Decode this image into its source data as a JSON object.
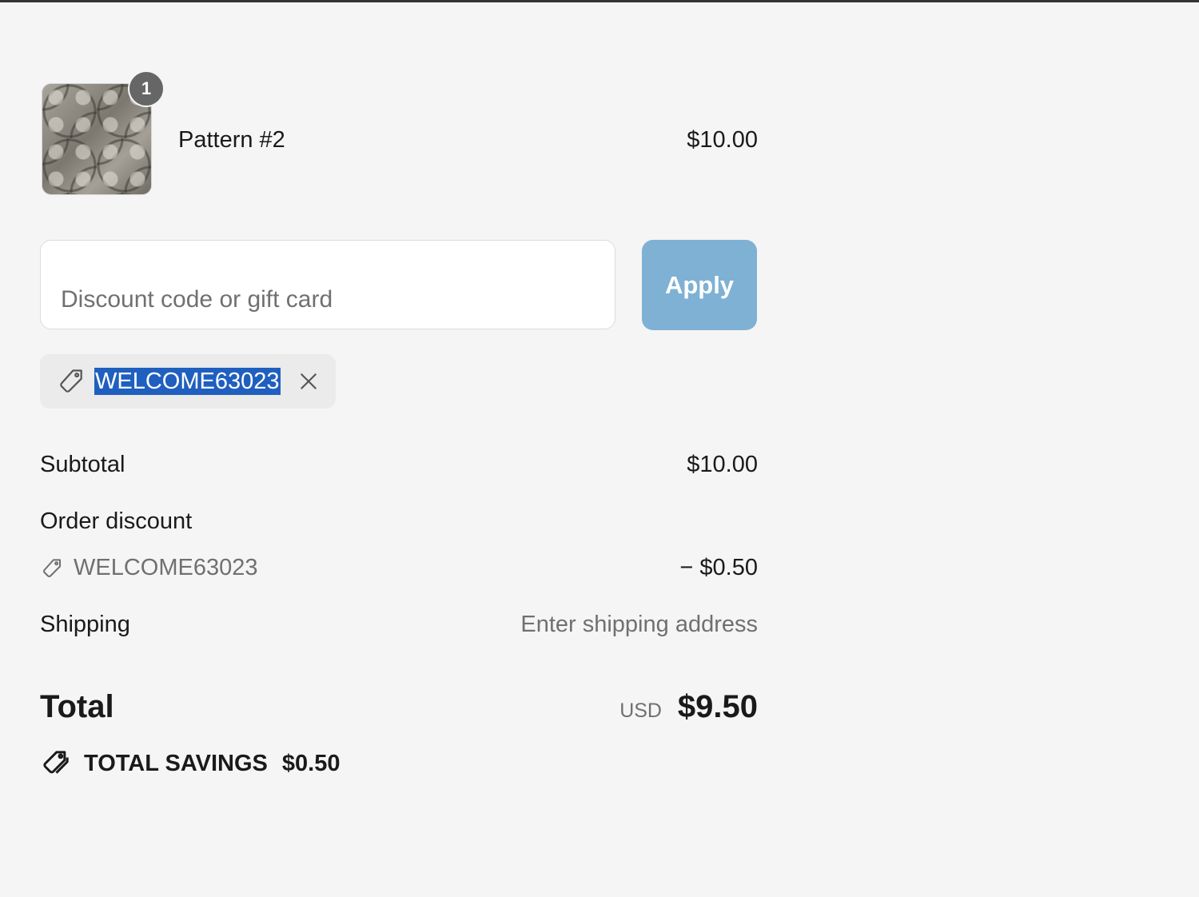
{
  "product": {
    "name": "Pattern #2",
    "price": "$10.00",
    "quantity": "1"
  },
  "discount": {
    "placeholder": "Discount code or gift card",
    "value": "",
    "apply_label": "Apply",
    "applied_code": "WELCOME63023"
  },
  "summary": {
    "subtotal_label": "Subtotal",
    "subtotal_value": "$10.00",
    "order_discount_label": "Order discount",
    "order_discount_code": "WELCOME63023",
    "order_discount_value": "− $0.50",
    "shipping_label": "Shipping",
    "shipping_value": "Enter shipping address",
    "total_label": "Total",
    "total_currency": "USD",
    "total_value": "$9.50",
    "savings_label": "TOTAL SAVINGS",
    "savings_value": "$0.50"
  },
  "icons": {
    "chip_tag": "tag-icon",
    "chip_remove": "close-icon",
    "discount_tag": "tag-icon",
    "savings": "savings-tag-icon"
  },
  "colors": {
    "apply_button": "#7eb1d4",
    "selection_highlight": "#1f5fbf",
    "badge": "#666666"
  }
}
